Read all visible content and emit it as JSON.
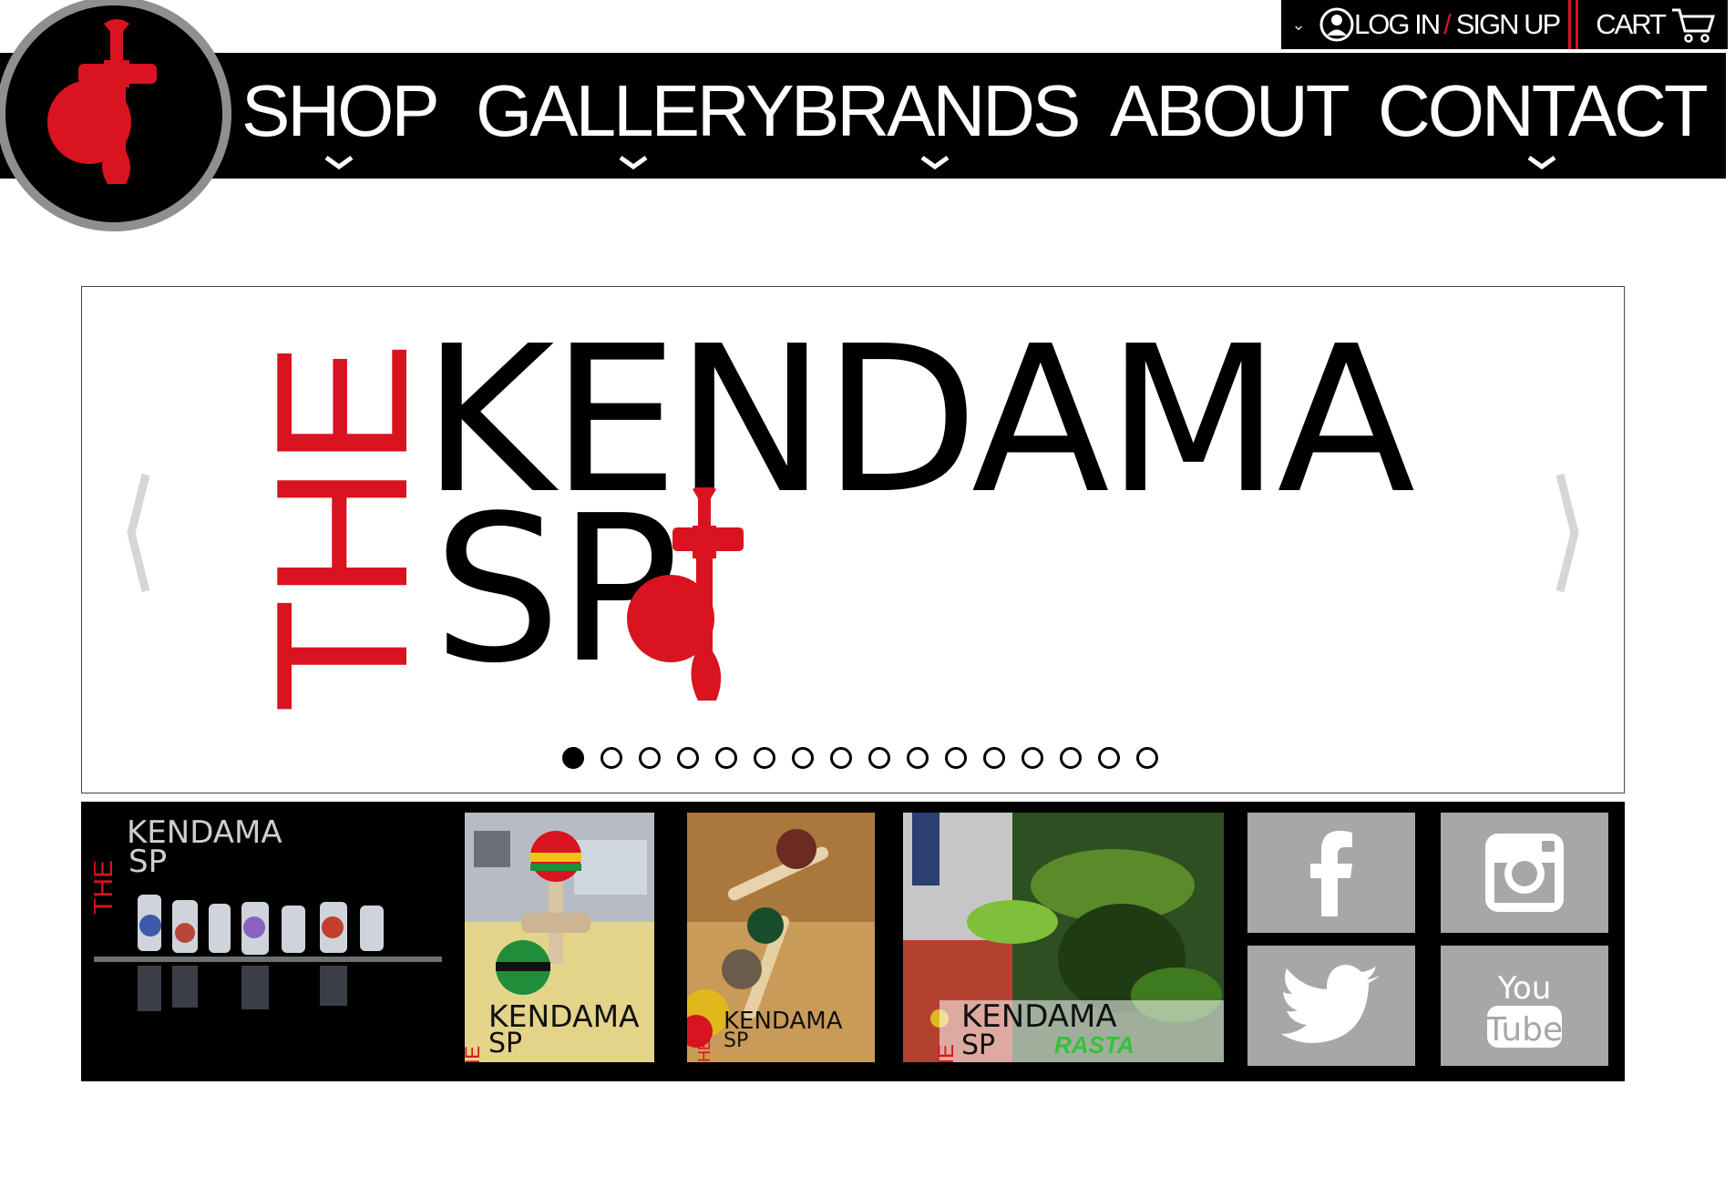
{
  "account": {
    "login_label": "LOG IN",
    "separator": "/",
    "signup_label": "SIGN UP",
    "cart_label": "CART"
  },
  "nav": {
    "items": [
      {
        "label": "SHOP"
      },
      {
        "label": "GALLERY"
      },
      {
        "label": "BRANDS"
      },
      {
        "label": "ABOUT"
      },
      {
        "label": "CONTACT"
      }
    ]
  },
  "hero": {
    "brand_the": "THE",
    "brand_kendama": "KENDAMA",
    "brand_spot": "SP",
    "slide_count": 16,
    "active_slide": 1
  },
  "gallery": {
    "captions": [
      {
        "the": "THE",
        "kendama": "KENDAMA",
        "spot": "SP"
      },
      {
        "the": "THE",
        "kendama": "KENDAMA",
        "spot": "SP"
      },
      {
        "the": "THE",
        "kendama": "KENDAMA",
        "spot": "SP"
      },
      {
        "the": "THE",
        "kendama": "KENDAMA",
        "spot": "SP",
        "tag": "RASTA"
      }
    ]
  },
  "social": [
    "facebook-icon",
    "instagram-icon",
    "twitter-icon",
    "youtube-icon"
  ],
  "colors": {
    "brand_red": "#d9131f",
    "social_gray": "#a7a7a7",
    "bar_black": "#000000"
  }
}
